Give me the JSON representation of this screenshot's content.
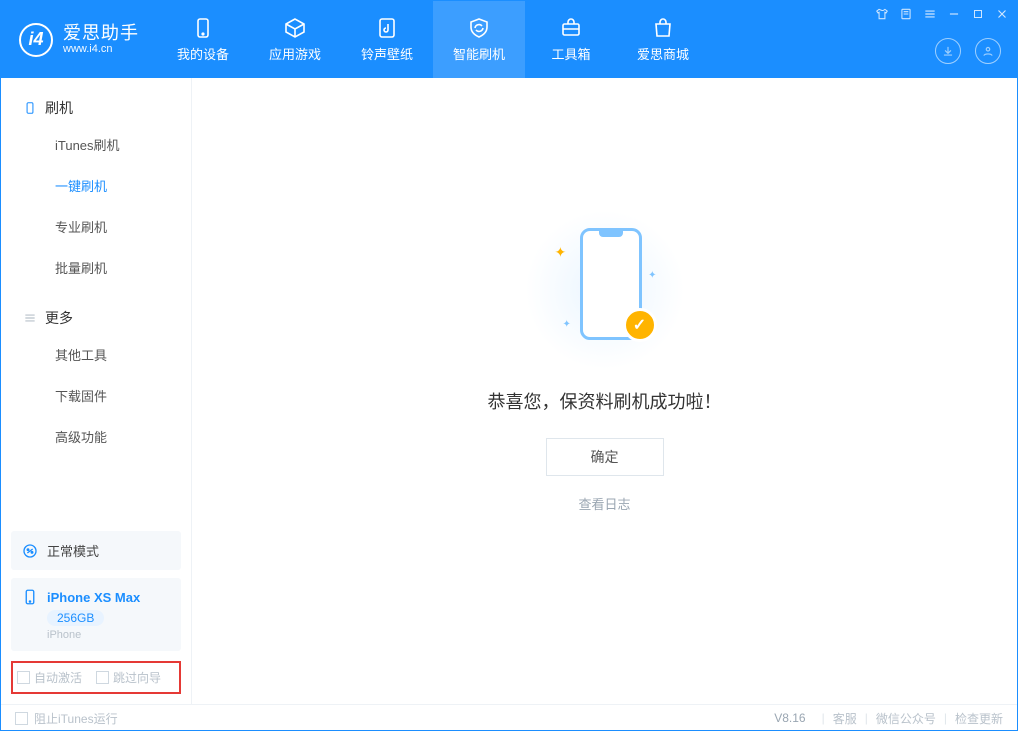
{
  "brand": {
    "name": "爱思助手",
    "url": "www.i4.cn"
  },
  "nav": {
    "items": [
      {
        "label": "我的设备"
      },
      {
        "label": "应用游戏"
      },
      {
        "label": "铃声壁纸"
      },
      {
        "label": "智能刷机"
      },
      {
        "label": "工具箱"
      },
      {
        "label": "爱思商城"
      }
    ]
  },
  "sidebar": {
    "section1": {
      "title": "刷机",
      "items": [
        {
          "label": "iTunes刷机"
        },
        {
          "label": "一键刷机"
        },
        {
          "label": "专业刷机"
        },
        {
          "label": "批量刷机"
        }
      ]
    },
    "section2": {
      "title": "更多",
      "items": [
        {
          "label": "其他工具"
        },
        {
          "label": "下载固件"
        },
        {
          "label": "高级功能"
        }
      ]
    },
    "status": {
      "label": "正常模式"
    },
    "device": {
      "name": "iPhone XS Max",
      "capacity": "256GB",
      "type": "iPhone"
    },
    "opts": {
      "auto_activate": "自动激活",
      "skip_guide": "跳过向导"
    }
  },
  "main": {
    "success_title": "恭喜您，保资料刷机成功啦！",
    "ok_button": "确定",
    "view_log": "查看日志"
  },
  "footer": {
    "block_itunes": "阻止iTunes运行",
    "version": "V8.16",
    "links": {
      "kefu": "客服",
      "wechat": "微信公众号",
      "update": "检查更新"
    }
  }
}
